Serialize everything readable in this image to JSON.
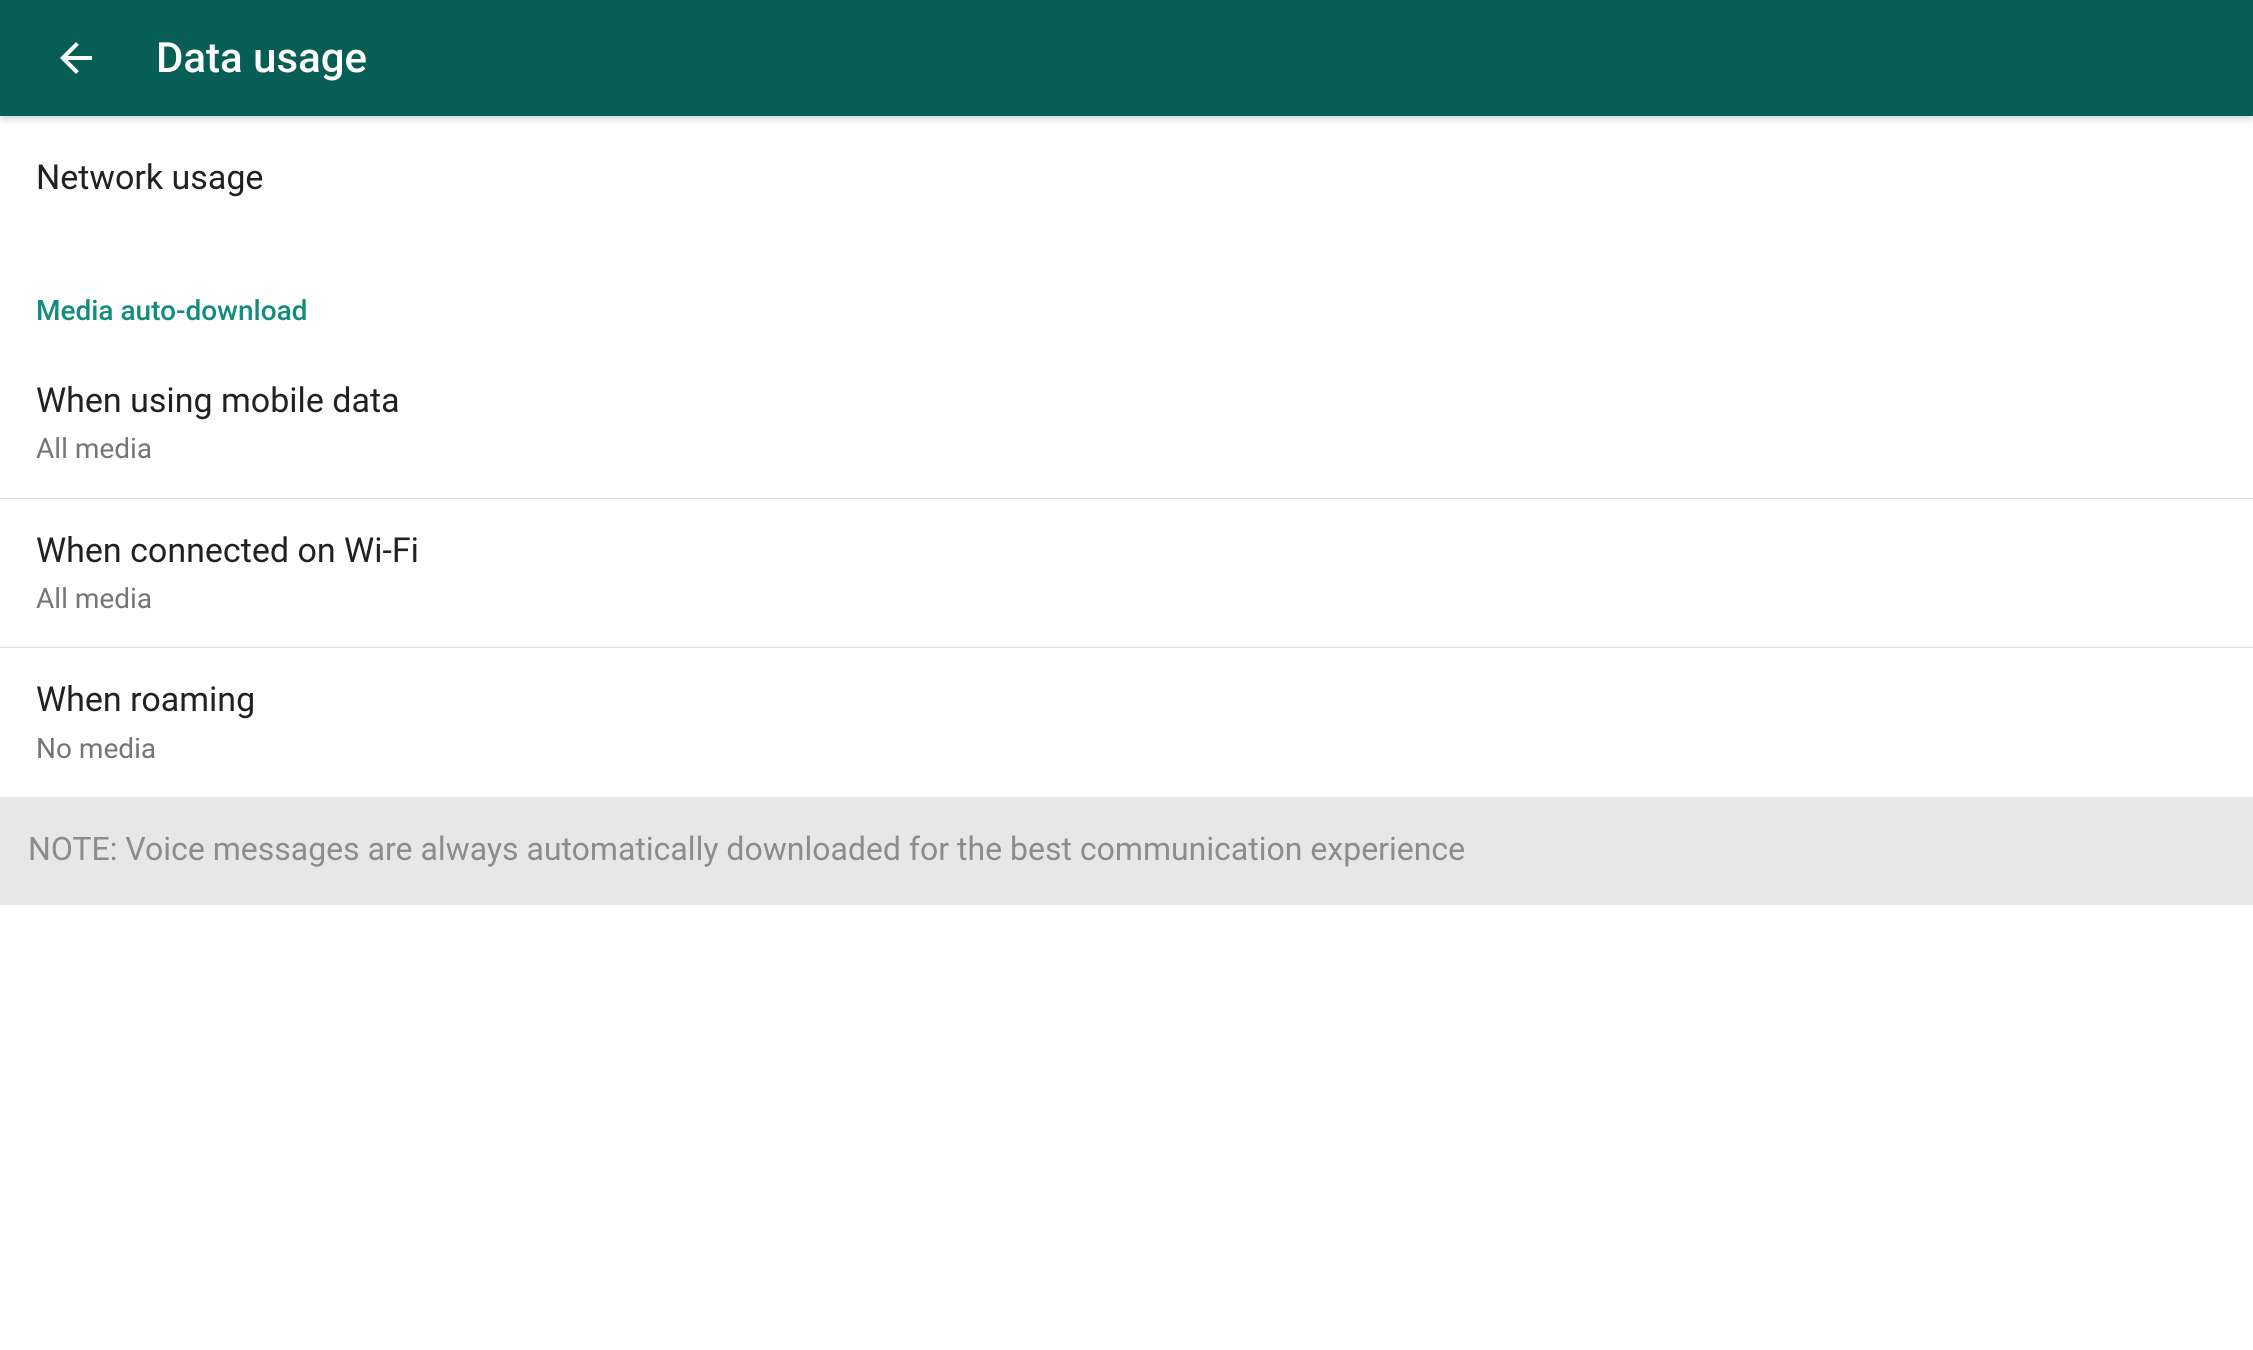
{
  "header": {
    "title": "Data usage"
  },
  "items": {
    "network_usage": {
      "title": "Network usage"
    }
  },
  "section": {
    "media_auto_download": {
      "header": "Media auto-download",
      "mobile_data": {
        "title": "When using mobile data",
        "subtitle": "All media"
      },
      "wifi": {
        "title": "When connected on Wi-Fi",
        "subtitle": "All media"
      },
      "roaming": {
        "title": "When roaming",
        "subtitle": "No media"
      }
    }
  },
  "note": "NOTE: Voice messages are always automatically downloaded for the best communication experience"
}
